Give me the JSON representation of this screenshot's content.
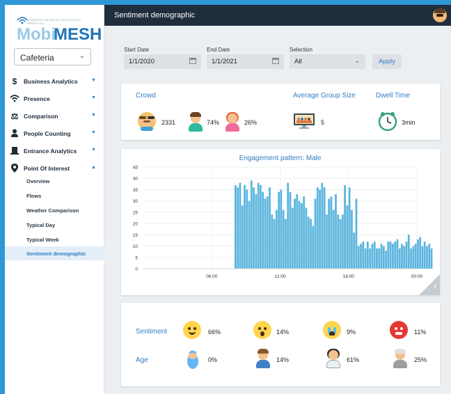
{
  "sidebar": {
    "logo_tagline": "ADVANCED NETWORK SOLUTIONS & PRODUCTS",
    "logo_part1": "Mobi",
    "logo_part2": "MESH",
    "site_selected": "Cafeteria",
    "items": [
      {
        "label": "Business Analytics",
        "icon": "dollar-icon"
      },
      {
        "label": "Presence",
        "icon": "wifi-icon"
      },
      {
        "label": "Comparison",
        "icon": "scale-icon"
      },
      {
        "label": "People Counting",
        "icon": "person-icon"
      },
      {
        "label": "Entrance Analytics",
        "icon": "door-icon"
      },
      {
        "label": "Point Of Interest",
        "icon": "map-pin-icon"
      }
    ],
    "subitems": [
      {
        "label": "Overview"
      },
      {
        "label": "Flows"
      },
      {
        "label": "Weather Comparison"
      },
      {
        "label": "Typical Day"
      },
      {
        "label": "Typical Week"
      },
      {
        "label": "Sentiment demographic"
      }
    ]
  },
  "topbar": {
    "title": "Sentiment demographic"
  },
  "filters": {
    "start_label": "Start Date",
    "start_value": "1/1/2020",
    "end_label": "End Date",
    "end_value": "1/1/2021",
    "selection_label": "Selection",
    "selection_value": "All",
    "apply_label": "Apply"
  },
  "kpis": {
    "crowd_label": "Crowd",
    "crowd_total": "2331",
    "male_pct": "74%",
    "female_pct": "26%",
    "group_label": "Average Group Size",
    "group_value": "5",
    "dwell_label": "Dwell Time",
    "dwell_value": "3min"
  },
  "chart_data": {
    "type": "bar",
    "title": "Engagement pattern: Male",
    "color": "#5bb5de",
    "ylim": [
      0,
      45
    ],
    "yticks": [
      0,
      5,
      10,
      15,
      20,
      25,
      30,
      35,
      40,
      45
    ],
    "xticks": [
      {
        "hour": 6,
        "label": "06:00"
      },
      {
        "hour": 12,
        "label": "12:00"
      },
      {
        "hour": 18,
        "label": "18:00"
      },
      {
        "hour": 24,
        "label": "00:00"
      }
    ],
    "start_hour": 8.0,
    "step_hours": 0.2,
    "values": [
      37,
      36,
      38,
      28,
      37,
      35,
      30,
      39,
      36,
      33,
      38,
      37,
      34,
      31,
      32,
      36,
      24,
      22,
      26,
      34,
      35,
      26,
      22,
      38,
      34,
      27,
      31,
      33,
      30,
      29,
      32,
      27,
      23,
      22,
      19,
      31,
      36,
      35,
      38,
      36,
      24,
      31,
      32,
      26,
      33,
      24,
      22,
      24,
      37,
      28,
      36,
      26,
      16,
      31,
      10,
      11,
      12,
      9,
      12,
      9,
      11,
      12,
      9,
      9,
      11,
      10,
      8,
      12,
      12,
      11,
      12,
      13,
      9,
      11,
      10,
      12,
      15,
      9,
      10,
      11,
      13,
      14,
      10,
      12,
      10,
      11,
      9
    ],
    "grid": true,
    "legend": "none"
  },
  "sentiment": {
    "label": "Sentiment",
    "items": [
      {
        "icon": "happy-face-icon",
        "value": "66%"
      },
      {
        "icon": "surprised-face-icon",
        "value": "14%"
      },
      {
        "icon": "crying-face-icon",
        "value": "9%"
      },
      {
        "icon": "angry-face-icon",
        "value": "11%"
      }
    ]
  },
  "age": {
    "label": "Age",
    "items": [
      {
        "icon": "baby-icon",
        "value": "0%"
      },
      {
        "icon": "young-adult-icon",
        "value": "14%"
      },
      {
        "icon": "adult-woman-icon",
        "value": "61%"
      },
      {
        "icon": "elderly-icon",
        "value": "25%"
      }
    ]
  }
}
